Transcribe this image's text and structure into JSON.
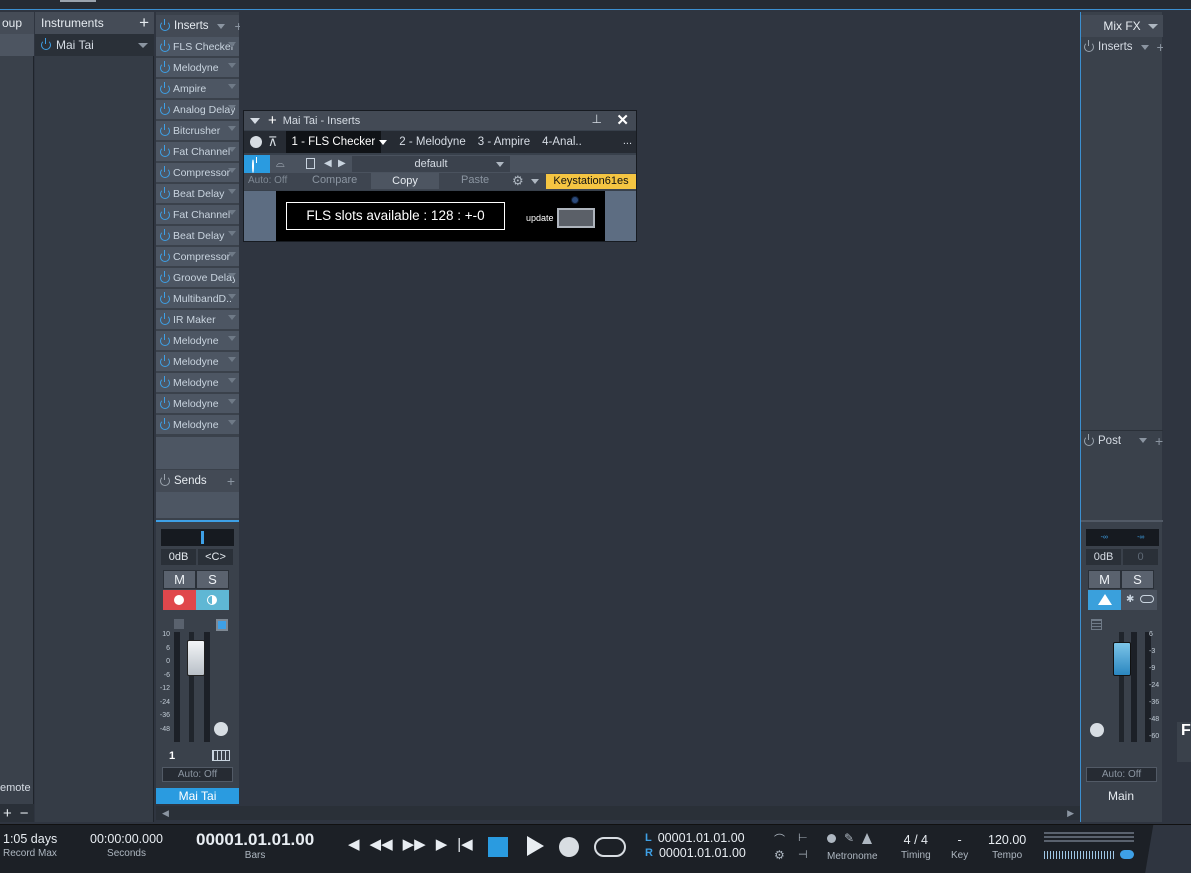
{
  "group_panel": {
    "header": "oup",
    "remote": "emote",
    "add": "+",
    "remove": "−"
  },
  "instruments": {
    "header": "Instruments",
    "add": "+",
    "item": "Mai Tai"
  },
  "strip": {
    "inserts_label": "Inserts",
    "inserts": [
      "FLS Checker",
      "Melodyne",
      "Ampire",
      "Analog Delay",
      "Bitcrusher",
      "Fat Channel",
      "Compressor",
      "Beat Delay",
      "Fat Channel",
      "Beat Delay",
      "Compressor",
      "Groove Delay",
      "MultibandD..",
      "IR Maker",
      "Melodyne",
      "Melodyne",
      "Melodyne",
      "Melodyne",
      "Melodyne"
    ],
    "sends_label": "Sends",
    "volume": "0dB",
    "pan": "<C>",
    "mute": "M",
    "solo": "S",
    "scale": [
      "10",
      "6",
      "0",
      "-6",
      "-12",
      "-24",
      "-36",
      "-48"
    ],
    "channel_number": "1",
    "auto": "Auto: Off",
    "name": "Mai Tai"
  },
  "plugin": {
    "title": "Mai Tai - Inserts",
    "tabs": [
      "1 - FLS Checker",
      "2 - Melodyne",
      "3 - Ampire",
      "4-Anal.."
    ],
    "more": "...",
    "preset": "default",
    "auto": "Auto: Off",
    "compare": "Compare",
    "copy": "Copy",
    "paste": "Paste",
    "device": "Keystation61es",
    "fls_text": "FLS slots available : 128 : +-0",
    "update": "update"
  },
  "mixfx": {
    "header": "Mix FX",
    "inserts_label": "Inserts",
    "post_label": "Post",
    "meter_l": "-∞",
    "meter_r": "-∞",
    "volume": "0dB",
    "pan": "0",
    "mute": "M",
    "solo": "S",
    "scale": [
      "6",
      "-3",
      "-9",
      "-24",
      "-36",
      "-48",
      "-60"
    ],
    "auto": "Auto: Off",
    "name": "Main"
  },
  "edge_letter": "F",
  "transport": {
    "record_value": "1:05 days",
    "record_label": "Record Max",
    "seconds_value": "00:00:00.000",
    "seconds_label": "Seconds",
    "bars_value": "00001.01.01.00",
    "bars_label": "Bars",
    "loop_l_label": "L",
    "loop_l": "00001.01.01.00",
    "loop_r_label": "R",
    "loop_r": "00001.01.01.00",
    "metronome_label": "Metronome",
    "timing_value": "4 / 4",
    "timing_label": "Timing",
    "key_value": "-",
    "key_label": "Key",
    "tempo_value": "120.00",
    "tempo_label": "Tempo"
  },
  "colors": {
    "accent": "#3ea0e6",
    "record": "#e0474c",
    "monitor": "#5fb7d4",
    "device_tag": "#f5c542"
  }
}
